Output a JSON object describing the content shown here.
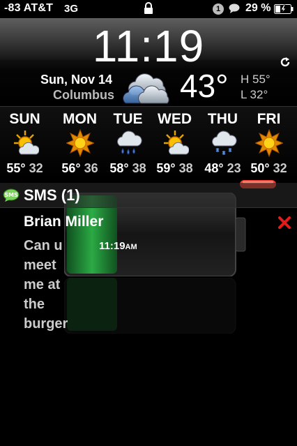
{
  "status_bar": {
    "carrier": "-83 AT&T",
    "network": "3G",
    "notification_count": "1",
    "battery_percent": "29 %",
    "icons": [
      "lock-icon",
      "notification-badge-icon",
      "chat-bubble-icon",
      "battery-charging-icon"
    ]
  },
  "clock": {
    "time": "11:19"
  },
  "weather": {
    "date": "Sun, Nov 14",
    "city": "Columbus",
    "current_temp": "43°",
    "high": "H 55°",
    "low": "L 32°",
    "condition_icon": "cloudy-icon"
  },
  "forecast": [
    {
      "day": "SUN",
      "high": "55°",
      "low": "32",
      "icon": "sun-cloud-icon"
    },
    {
      "day": "MON",
      "high": "56°",
      "low": "36",
      "icon": "sun-icon"
    },
    {
      "day": "TUE",
      "high": "58°",
      "low": "38",
      "icon": "rain-icon"
    },
    {
      "day": "WED",
      "high": "59°",
      "low": "38",
      "icon": "sun-cloud-icon"
    },
    {
      "day": "THU",
      "high": "48°",
      "low": "23",
      "icon": "snow-icon"
    },
    {
      "day": "FRI",
      "high": "50°",
      "low": "32",
      "icon": "sun-icon"
    }
  ],
  "sms": {
    "title": "SMS (1)",
    "sender": "Brian Miller",
    "body_lines": [
      "Can u",
      "meet",
      "me at",
      "the",
      "burger"
    ],
    "time": "11:19",
    "ampm": "AM"
  },
  "colors": {
    "close_x": "#e41b1b",
    "battery_green": "#1fa83b",
    "battery_cap_red": "#ff3a2a"
  }
}
